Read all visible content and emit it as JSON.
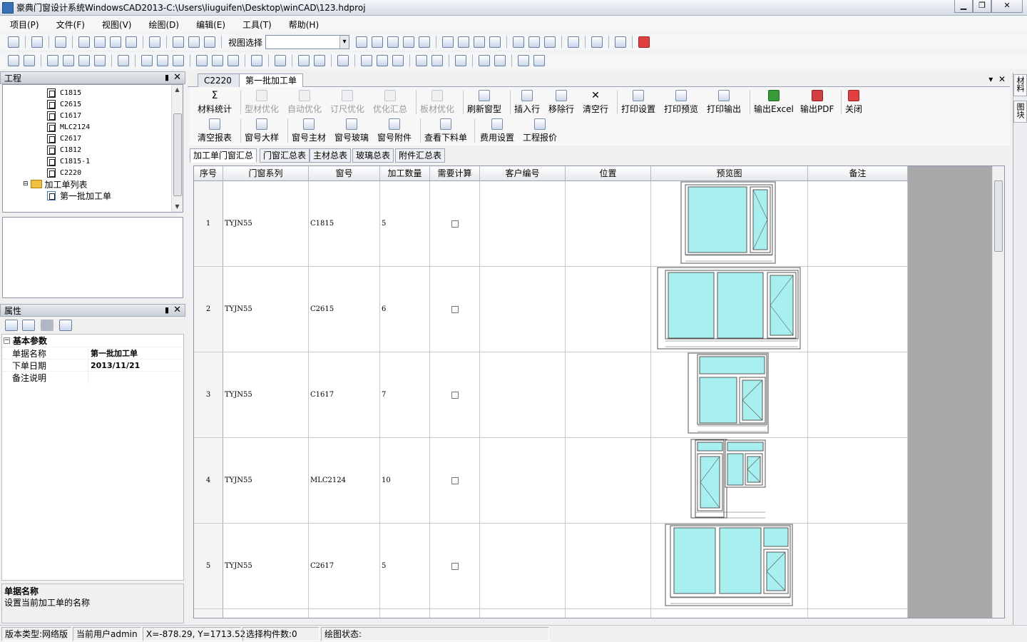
{
  "window": {
    "title": "豪典门窗设计系统WindowsCAD2013-C:\\Users\\liuguifen\\Desktop\\winCAD\\123.hdproj"
  },
  "menu": [
    "项目(P)",
    "文件(F)",
    "视图(V)",
    "绘图(D)",
    "编辑(E)",
    "工具(T)",
    "帮助(H)"
  ],
  "toolbar": {
    "view_select_label": "视图选择",
    "view_select_value": ""
  },
  "project_panel": {
    "title": "工程",
    "tree": [
      "C1815",
      "C2615",
      "C1617",
      "MLC2124",
      "C2617",
      "C1812",
      "C1815-1",
      "C2220"
    ],
    "folder": "加工单列表",
    "child": "第一批加工单"
  },
  "props_panel": {
    "title": "属性",
    "category": "基本参数",
    "rows": [
      {
        "k": "单据名称",
        "v": "第一批加工单"
      },
      {
        "k": "下单日期",
        "v": "2013/11/21"
      },
      {
        "k": "备注说明",
        "v": ""
      }
    ],
    "desc_title": "单据名称",
    "desc_text": "设置当前加工单的名称"
  },
  "doc_tabs": [
    "C2220",
    "第一批加工单"
  ],
  "ribbon": {
    "row1": [
      "材料统计",
      "型材优化",
      "自动优化",
      "订尺优化",
      "优化汇总",
      "板材优化",
      "刷新窗型",
      "插入行",
      "移除行",
      "清空行",
      "打印设置",
      "打印预览",
      "打印输出",
      "输出Excel",
      "输出PDF",
      "关闭"
    ],
    "row2": [
      "清空报表",
      "窗号大样",
      "窗号主材",
      "窗号玻璃",
      "窗号附件",
      "查看下料单",
      "费用设置",
      "工程报价"
    ]
  },
  "sub_tabs": [
    "加工单门窗汇总",
    "门窗汇总表",
    "主材总表",
    "玻璃总表",
    "附件汇总表"
  ],
  "grid": {
    "headers": [
      "序号",
      "门窗系列",
      "窗号",
      "加工数量",
      "需要计算",
      "客户编号",
      "位置",
      "预览图",
      "备注"
    ],
    "rows": [
      {
        "no": "1",
        "series": "TYJN55",
        "code": "C1815",
        "qty": "5"
      },
      {
        "no": "2",
        "series": "TYJN55",
        "code": "C2615",
        "qty": "6"
      },
      {
        "no": "3",
        "series": "TYJN55",
        "code": "C1617",
        "qty": "7"
      },
      {
        "no": "4",
        "series": "TYJN55",
        "code": "MLC2124",
        "qty": "10"
      },
      {
        "no": "5",
        "series": "TYJN55",
        "code": "C2617",
        "qty": "5"
      }
    ]
  },
  "right_side_tabs": [
    "材料",
    "图块"
  ],
  "status": [
    "版本类型:网络版",
    "当前用户admin",
    "X=-878.29, Y=1713.52",
    "选择构件数:0",
    "绘图状态:"
  ],
  "colors": {
    "glass": "#a8f0f0",
    "frame": "#555555",
    "panel_header": "#c9ced6"
  }
}
